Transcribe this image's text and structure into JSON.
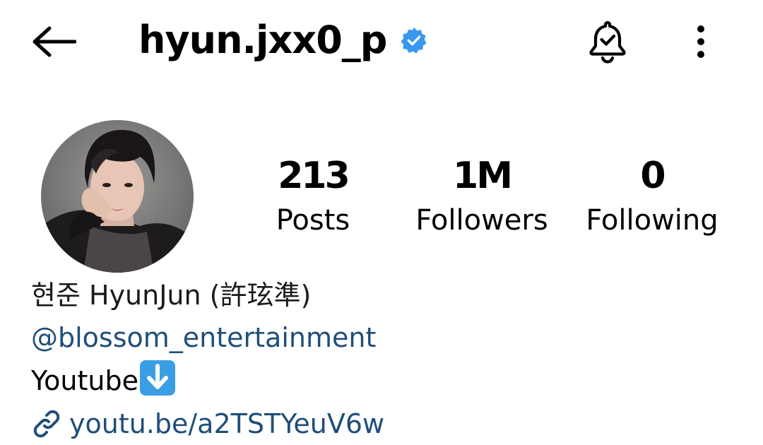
{
  "header": {
    "username": "hyun.jxx0_p",
    "verified": true,
    "back_icon": "arrow-left-icon",
    "bell_icon": "bell-check-icon",
    "more_icon": "more-vertical-icon"
  },
  "profile": {
    "avatar_alt": "profile photo"
  },
  "stats": [
    {
      "value": "213",
      "label": "Posts"
    },
    {
      "value": "1M",
      "label": "Followers"
    },
    {
      "value": "0",
      "label": "Following"
    }
  ],
  "bio": {
    "name_line": "현준 HyunJun (許玹準)",
    "mention": "@blossom_entertainment",
    "text_line": "Youtube",
    "emoji": "down-arrow-emoji",
    "link": "youtu.be/a2TSTYeuV6w"
  },
  "colors": {
    "verified_blue": "#3897f0",
    "link_blue": "#1f4e7a",
    "emoji_blue": "#3a9ee4"
  }
}
